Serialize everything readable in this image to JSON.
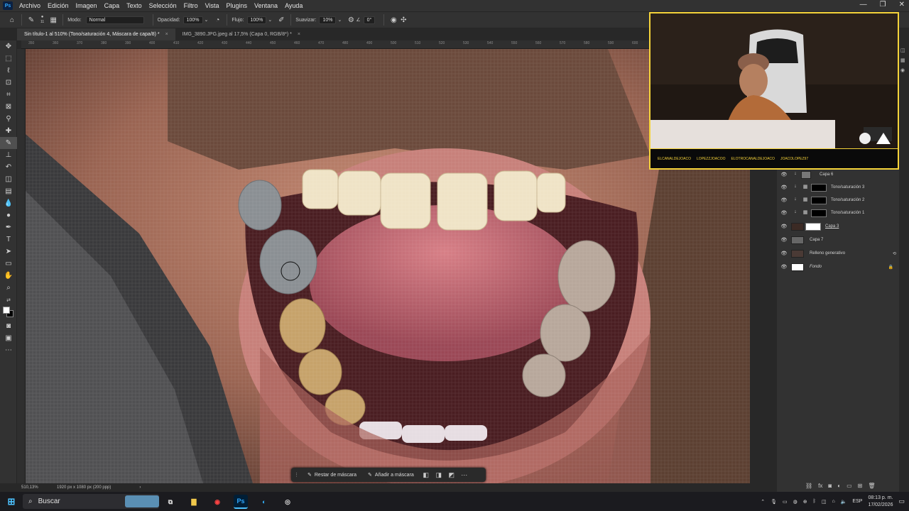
{
  "app": {
    "name": "Ps"
  },
  "menu": [
    "Archivo",
    "Edición",
    "Imagen",
    "Capa",
    "Texto",
    "Selección",
    "Filtro",
    "Vista",
    "Plugins",
    "Ventana",
    "Ayuda"
  ],
  "options": {
    "brush_size": "11",
    "mode_label": "Modo:",
    "mode_value": "Normal",
    "opacity_label": "Opacidad:",
    "opacity_value": "100%",
    "flow_label": "Flujo:",
    "flow_value": "100%",
    "smoothing_label": "Suavizar:",
    "smoothing_value": "10%",
    "angle_value": "0°"
  },
  "tabs": [
    {
      "label": "Sin título-1 al 510% (Tono/saturación 4, Máscara de capa/8) *",
      "close": "×"
    },
    {
      "label": "IMG_3890.JPG.jpeg al 17,5% (Capa 0, RGB/8*) *",
      "close": "×"
    }
  ],
  "ruler_ticks": [
    "350",
    "360",
    "370",
    "380",
    "390",
    "400",
    "410",
    "420",
    "430",
    "440",
    "450",
    "460",
    "470",
    "480",
    "490",
    "500",
    "510",
    "520",
    "530",
    "540",
    "550",
    "560",
    "570",
    "580",
    "590",
    "600",
    "610",
    "620",
    "630",
    "640",
    "650"
  ],
  "contextual_bar": {
    "subtract": "Restar de máscara",
    "add": "Añadir a máscara"
  },
  "status": {
    "zoom": "510,13%",
    "doc": "1920 px x 1080 px (200 ppp)"
  },
  "layers": [
    {
      "name": "Capa 6"
    },
    {
      "name": "Tono/saturación 3"
    },
    {
      "name": "Tono/saturación 2"
    },
    {
      "name": "Tono/saturación 1"
    },
    {
      "name": "Capa 3"
    },
    {
      "name": "Capa 7"
    },
    {
      "name": "Relleno generativo"
    },
    {
      "name": "Fondo"
    }
  ],
  "webcam": {
    "handles": [
      "ELCANALDEJOACO",
      "LOPEZZJOACOO",
      "ELOTROCANALDEJOACO",
      "JOACOLOPEZ97"
    ]
  },
  "windows_taskbar": {
    "search_label": "Buscar",
    "lang": "ESP",
    "time": "08:13 p. m.",
    "date": "17/02/2026"
  },
  "colors": {
    "accent_yellow": "#f5d33a",
    "ps_blue": "#31a8ff"
  }
}
